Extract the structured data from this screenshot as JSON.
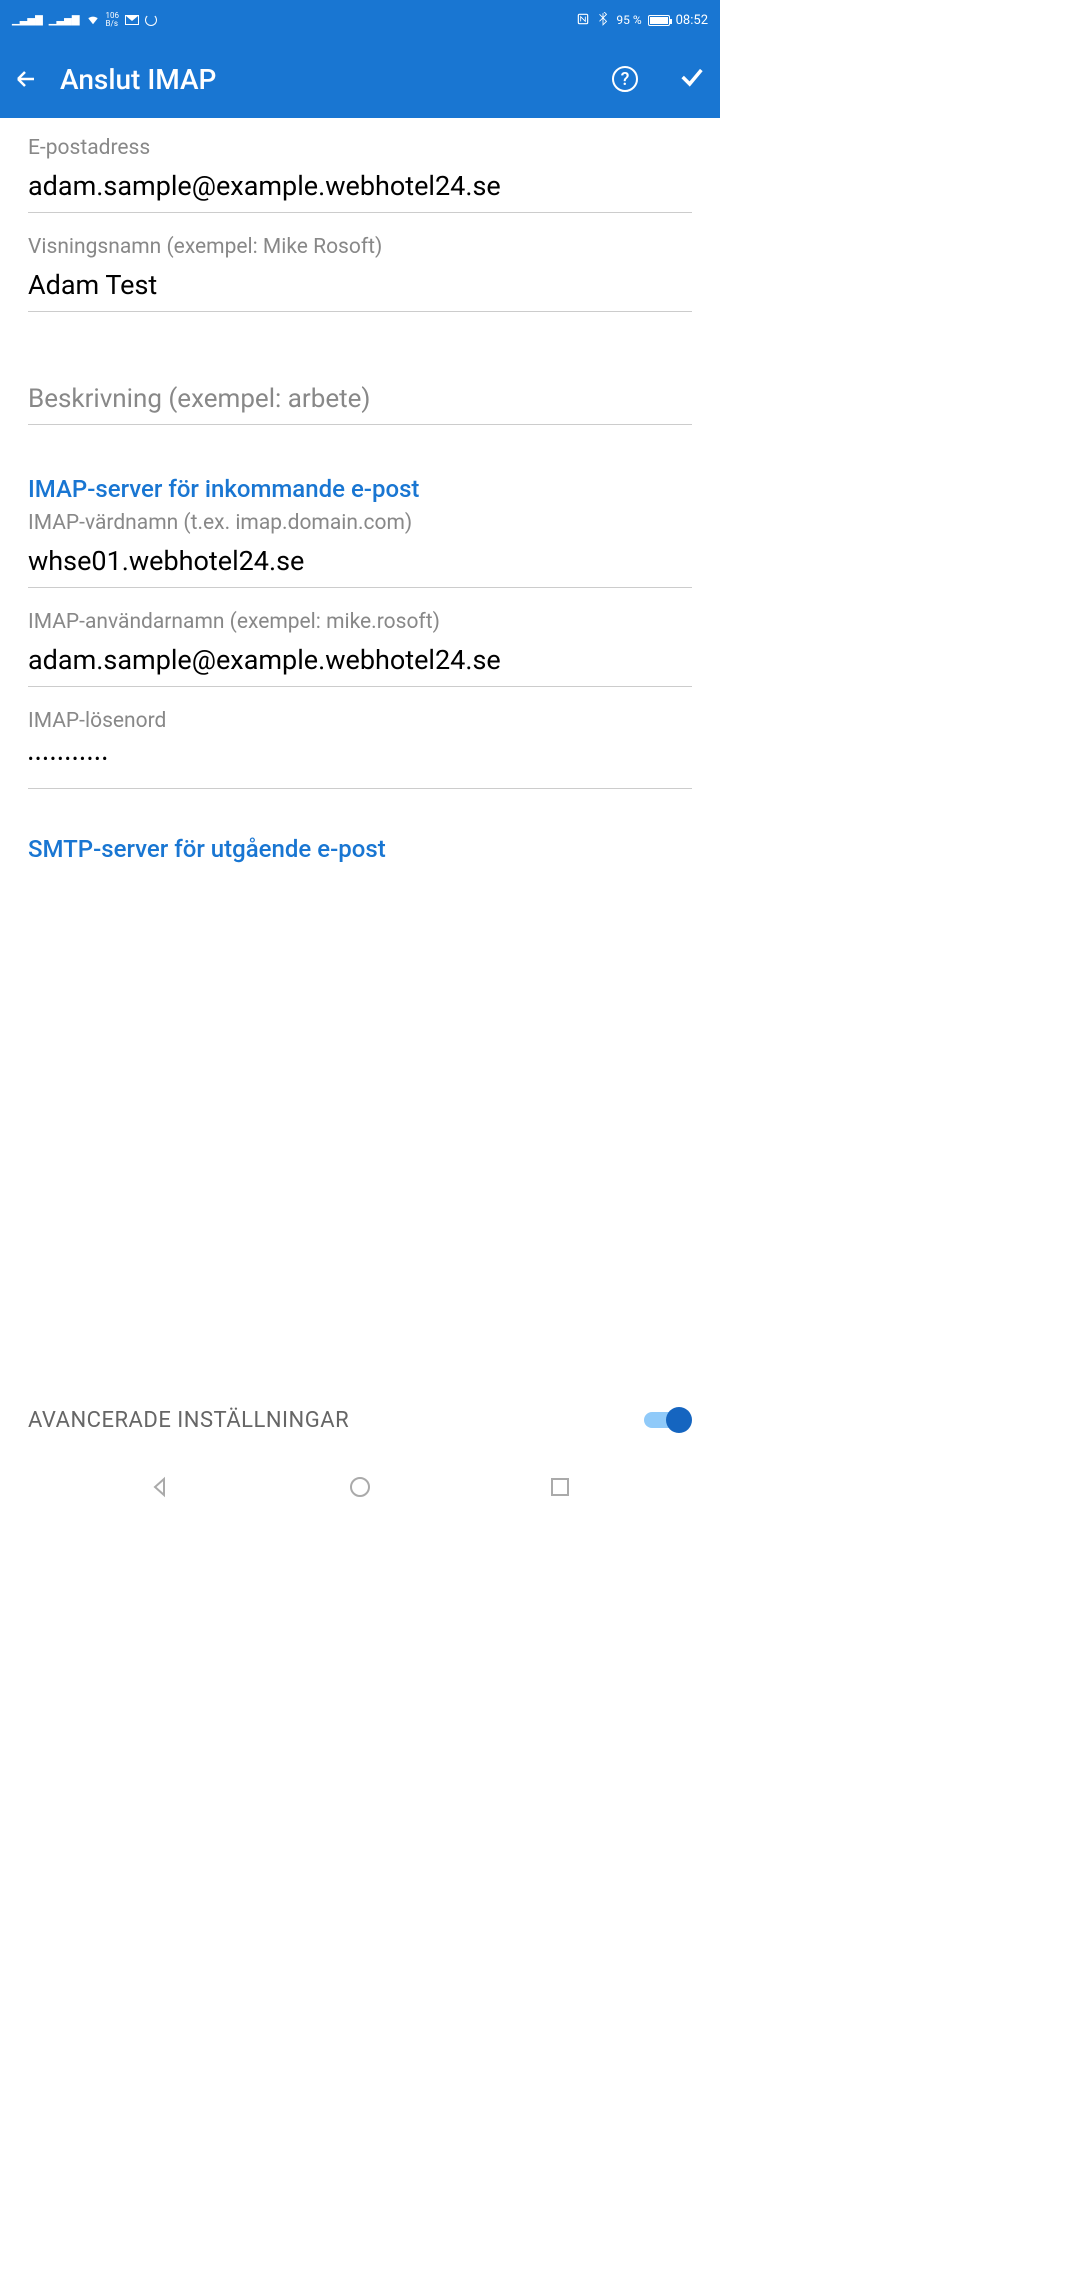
{
  "status": {
    "net_speed_top": "106",
    "net_speed_bottom": "B/s",
    "battery_pct": "95 %",
    "clock": "08:52"
  },
  "header": {
    "title": "Anslut IMAP"
  },
  "fields": {
    "email": {
      "label": "E-postadress",
      "value": "adam.sample@example.webhotel24.se"
    },
    "display_name": {
      "label": "Visningsnamn (exempel: Mike Rosoft)",
      "value": "Adam Test"
    },
    "description": {
      "placeholder": "Beskrivning (exempel: arbete)",
      "value": ""
    }
  },
  "sections": {
    "imap": {
      "title": "IMAP-server för inkommande e-post",
      "hostname": {
        "label": "IMAP-värdnamn (t.ex. imap.domain.com)",
        "value": "whse01.webhotel24.se"
      },
      "username": {
        "label": "IMAP-användarnamn (exempel: mike.rosoft)",
        "value": "adam.sample@example.webhotel24.se"
      },
      "password": {
        "label": "IMAP-lösenord",
        "value": "•••••••••••"
      }
    },
    "smtp": {
      "title": "SMTP-server för utgående e-post"
    }
  },
  "advanced": {
    "label": "AVANCERADE INSTÄLLNINGAR",
    "enabled": true
  }
}
